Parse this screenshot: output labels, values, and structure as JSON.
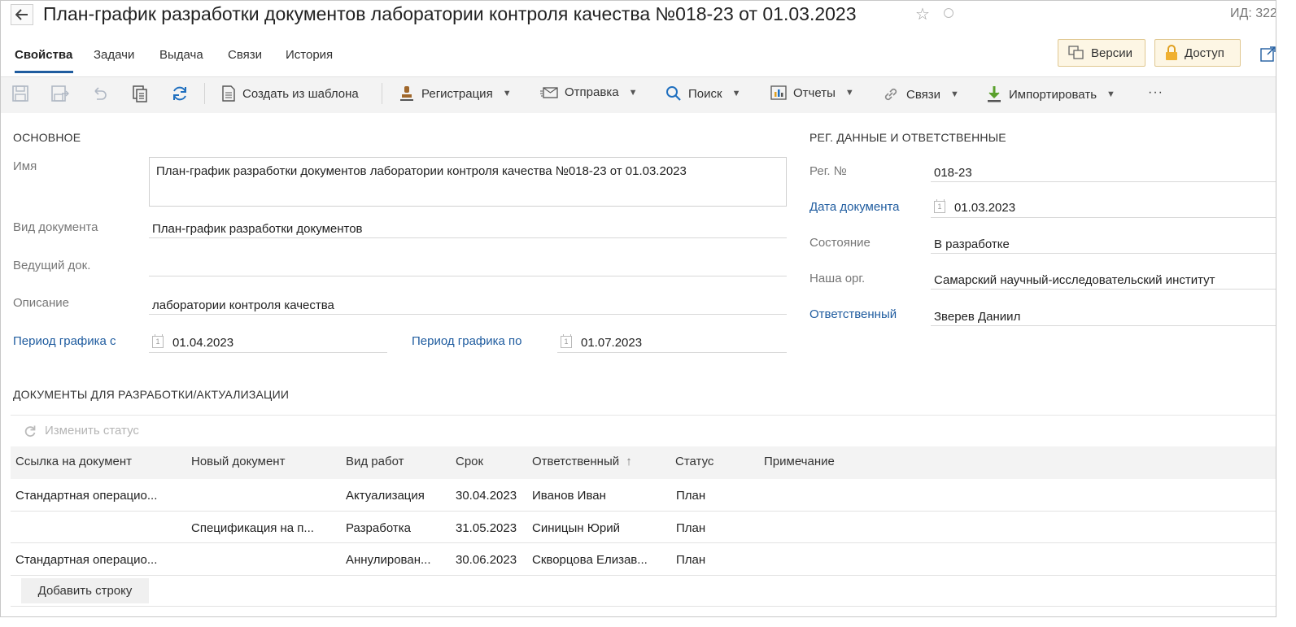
{
  "header": {
    "title": "План-график разработки документов лаборатории контроля качества №018-23 от 01.03.2023",
    "id_label": "ИД: 322"
  },
  "tabs": [
    {
      "label": "Свойства",
      "active": true
    },
    {
      "label": "Задачи"
    },
    {
      "label": "Выдача"
    },
    {
      "label": "Связи"
    },
    {
      "label": "История"
    }
  ],
  "top_buttons": {
    "versions": "Версии",
    "access": "Доступ"
  },
  "toolbar": {
    "create_from_template": "Создать из шаблона",
    "registration": "Регистрация",
    "sending": "Отправка",
    "search": "Поиск",
    "reports": "Отчеты",
    "links": "Связи",
    "import": "Импортировать",
    "more": "···"
  },
  "main_section": {
    "title": "ОСНОВНОЕ",
    "name_label": "Имя",
    "name_value": "План-график разработки документов лаборатории контроля качества №018-23 от 01.03.2023",
    "doc_type_label": "Вид документа",
    "doc_type_value": "План-график разработки документов",
    "lead_doc_label": "Ведущий док.",
    "lead_doc_value": "",
    "description_label": "Описание",
    "description_value": "лаборатории контроля качества",
    "period_from_label": "Период графика с",
    "period_from_value": "01.04.2023",
    "period_to_label": "Период графика по",
    "period_to_value": "01.07.2023"
  },
  "reg_section": {
    "title": "РЕГ. ДАННЫЕ И ОТВЕТСТВЕННЫЕ",
    "reg_no_label": "Рег. №",
    "reg_no_value": "018-23",
    "doc_date_label": "Дата документа",
    "doc_date_value": "01.03.2023",
    "state_label": "Состояние",
    "state_value": "В разработке",
    "our_org_label": "Наша орг.",
    "our_org_value": "Самарский научный-исследовательский институт",
    "responsible_label": "Ответственный",
    "responsible_value": "Зверев Даниил"
  },
  "docs_section": {
    "title": "ДОКУМЕНТЫ ДЛЯ РАЗРАБОТКИ/АКТУАЛИЗАЦИИ",
    "change_status": "Изменить статус",
    "columns": [
      "Ссылка на документ",
      "Новый документ",
      "Вид работ",
      "Срок",
      "Ответственный",
      "Статус",
      "Примечание"
    ],
    "rows": [
      [
        "Стандартная операцио...",
        "",
        "Актуализация",
        "30.04.2023",
        "Иванов Иван",
        "План",
        ""
      ],
      [
        "",
        "Спецификация на п...",
        "Разработка",
        "31.05.2023",
        "Синицын Юрий",
        "План",
        ""
      ],
      [
        "Стандартная операцио...",
        "",
        "Аннулирован...",
        "30.06.2023",
        "Скворцова Елизав...",
        "План",
        ""
      ]
    ],
    "add_row": "Добавить строку"
  }
}
